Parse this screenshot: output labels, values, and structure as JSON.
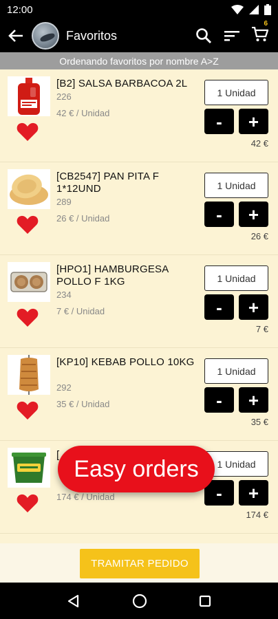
{
  "status": {
    "time": "12:00"
  },
  "appbar": {
    "title": "Favoritos",
    "cart_count": "6"
  },
  "sortbar": {
    "text": "Ordenando favoritos por nombre A>Z"
  },
  "products": [
    {
      "name": "[B2] SALSA BARBACOA 2L",
      "code": "226",
      "price": "42 € / Unidad",
      "qty": "1 Unidad",
      "total": "42 €",
      "image": "sauce-bottle-image"
    },
    {
      "name": "[CB2547] PAN PITA F 1*12UND",
      "code": "289",
      "price": "26 € / Unidad",
      "qty": "1 Unidad",
      "total": "26 €",
      "image": "pita-bread-image"
    },
    {
      "name": "[HPO1] HAMBURGESA POLLO F 1KG",
      "code": "234",
      "price": "7 € / Unidad",
      "qty": "1 Unidad",
      "total": "7 €",
      "image": "burger-pack-image"
    },
    {
      "name": "[KP10] KEBAB POLLO 10KG",
      "code": "292",
      "price": "35 € / Unidad",
      "qty": "1 Unidad",
      "total": "35 €",
      "image": "kebab-image"
    },
    {
      "name": "[",
      "code": "",
      "price": "174 € / Unidad",
      "qty": "1 Unidad",
      "total": "174 €",
      "image": "bucket-image"
    }
  ],
  "checkout_label": "TRAMITAR PEDIDO",
  "overlay_label": "Easy orders",
  "controls": {
    "minus": "-",
    "plus": "+"
  }
}
